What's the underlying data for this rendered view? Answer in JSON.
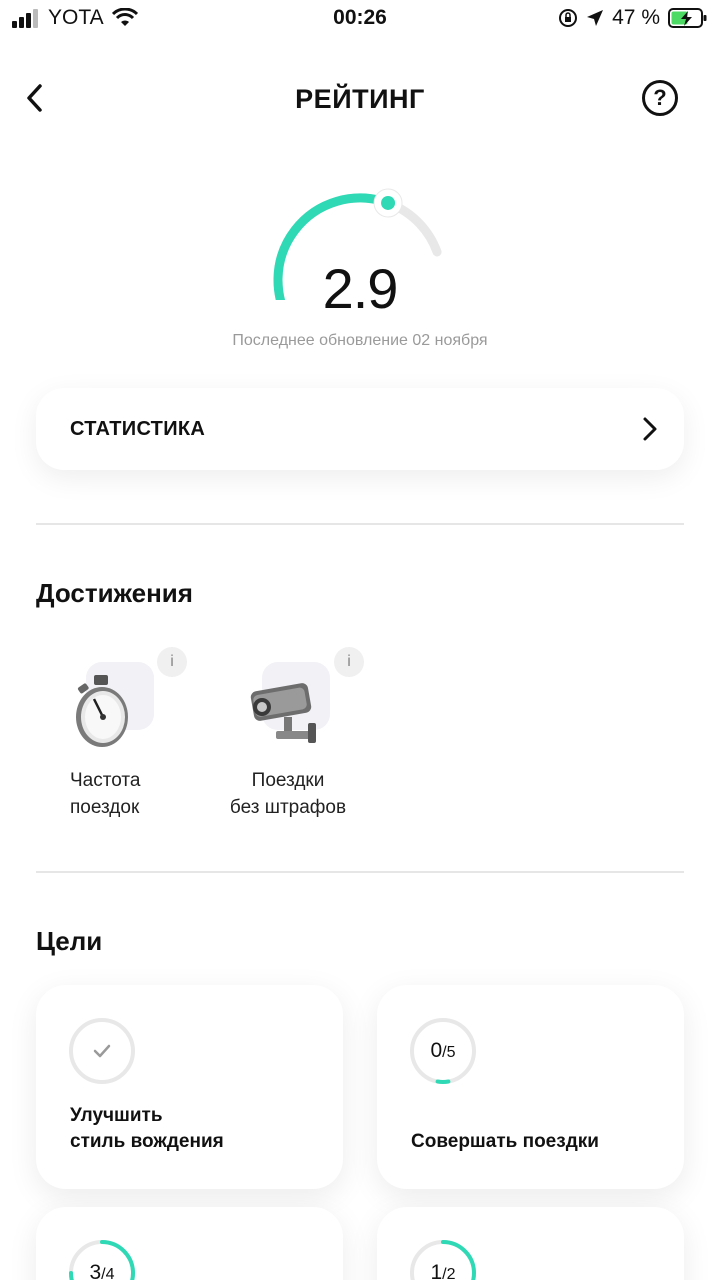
{
  "status_bar": {
    "carrier": "YOTA",
    "time": "00:26",
    "battery_percent": "47 %",
    "icons": [
      "signal-icon",
      "wifi-icon",
      "orientation-lock-icon",
      "location-icon",
      "battery-charging-icon"
    ]
  },
  "nav": {
    "title": "РЕЙТИНГ",
    "back_icon": "chevron-left-icon",
    "help_label": "?"
  },
  "rating": {
    "value": "2.9",
    "gauge_fraction": 0.58,
    "updated": "Последнее обновление 02 ноября"
  },
  "stats": {
    "label": "СТАТИСТИКА"
  },
  "achievements": {
    "title": "Достижения",
    "items": [
      {
        "line1": "Частота",
        "line2": "поездок",
        "icon": "stopwatch-icon",
        "info": "i"
      },
      {
        "line1": "Поездки",
        "line2": "без штрафов",
        "icon": "traffic-camera-icon",
        "info": "i"
      }
    ]
  },
  "goals": {
    "title": "Цели",
    "items": [
      {
        "done": true,
        "title1": "Улучшить",
        "title2": "стиль вождения"
      },
      {
        "current": "0",
        "total": "/5",
        "fraction": 0.03,
        "title1": "",
        "title2": "Совершать поездки"
      },
      {
        "current": "3",
        "total": "/4",
        "fraction": 0.75
      },
      {
        "current": "1",
        "total": "/2",
        "fraction": 0.5
      }
    ]
  },
  "colors": {
    "accent": "#2fd9b5",
    "track": "#e8e8e8",
    "muted_text": "#9a9a9a"
  }
}
